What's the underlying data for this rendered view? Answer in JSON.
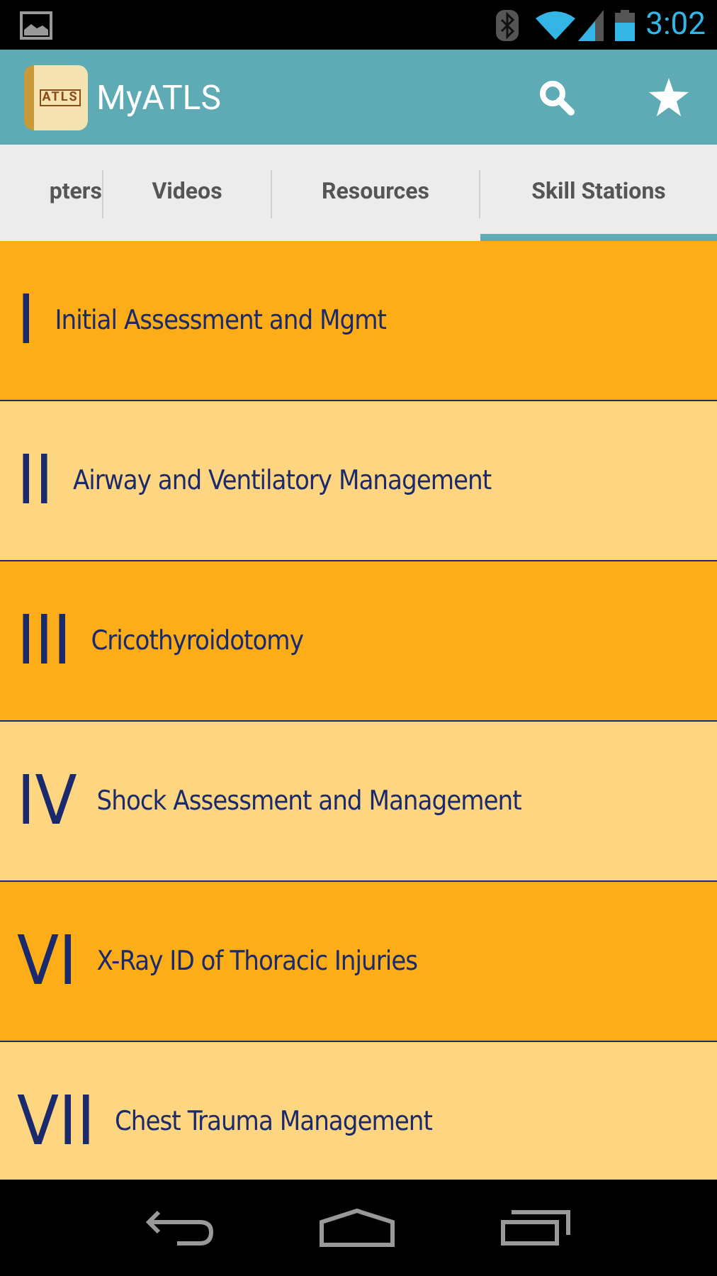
{
  "status_bar": {
    "time": "3:02"
  },
  "app_bar": {
    "title": "MyATLS",
    "logo_text": "ATLS"
  },
  "tabs": [
    {
      "label": "pters",
      "selected": false
    },
    {
      "label": "Videos",
      "selected": false
    },
    {
      "label": "Resources",
      "selected": false
    },
    {
      "label": "Skill Stations",
      "selected": true
    }
  ],
  "stations": [
    {
      "numeral": "I",
      "title": "Initial Assessment and Mgmt"
    },
    {
      "numeral": "II",
      "title": "Airway and Ventilatory Management"
    },
    {
      "numeral": "III",
      "title": "Cricothyroidotomy"
    },
    {
      "numeral": "IV",
      "title": "Shock Assessment and Management"
    },
    {
      "numeral": "VI",
      "title": "X-Ray ID of Thoracic Injuries"
    },
    {
      "numeral": "VII",
      "title": "Chest Trauma Management"
    }
  ]
}
